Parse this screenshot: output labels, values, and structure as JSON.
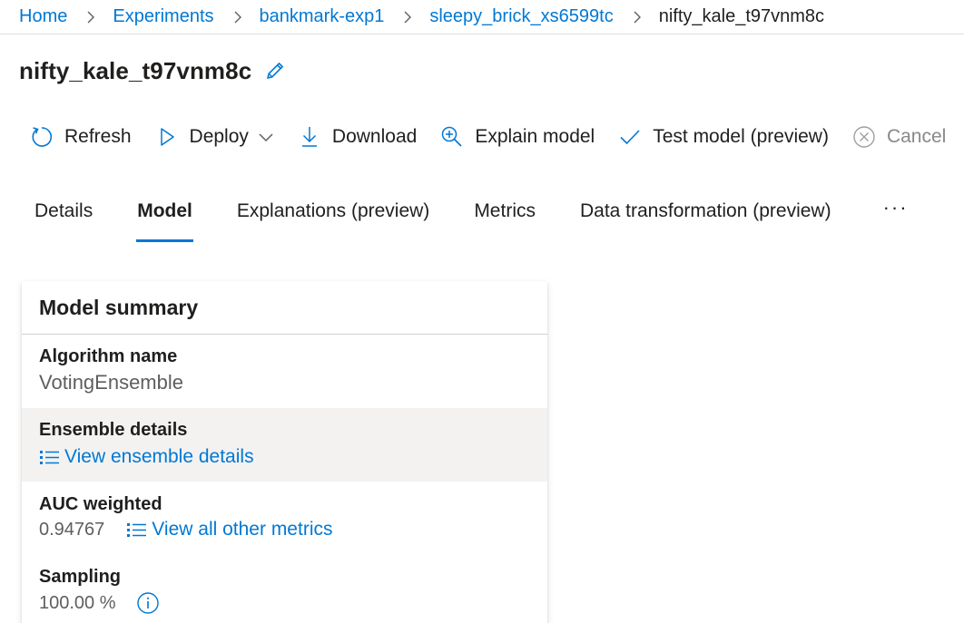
{
  "breadcrumb": {
    "items": [
      {
        "label": "Home"
      },
      {
        "label": "Experiments"
      },
      {
        "label": "bankmark-exp1"
      },
      {
        "label": "sleepy_brick_xs6599tc"
      },
      {
        "label": "nifty_kale_t97vnm8c"
      }
    ]
  },
  "page": {
    "title": "nifty_kale_t97vnm8c"
  },
  "toolbar": {
    "refresh": "Refresh",
    "deploy": "Deploy",
    "download": "Download",
    "explain": "Explain model",
    "test": "Test model (preview)",
    "cancel": "Cancel"
  },
  "tabs": {
    "items": [
      {
        "label": "Details"
      },
      {
        "label": "Model"
      },
      {
        "label": "Explanations (preview)"
      },
      {
        "label": "Metrics"
      },
      {
        "label": "Data transformation (preview)"
      }
    ],
    "active": "Model",
    "more": "···"
  },
  "model_summary": {
    "title": "Model summary",
    "algorithm_label": "Algorithm name",
    "algorithm_value": "VotingEnsemble",
    "ensemble_label": "Ensemble details",
    "ensemble_link": "View ensemble details",
    "auc_label": "AUC weighted",
    "auc_value": "0.94767",
    "metrics_link": "View all other metrics",
    "sampling_label": "Sampling",
    "sampling_value": "100.00 %"
  },
  "colors": {
    "accent": "#0078d4",
    "text": "#201f1e",
    "muted": "#605e5c",
    "disabled": "#8a8886",
    "row_highlight": "#f3f2f1"
  }
}
